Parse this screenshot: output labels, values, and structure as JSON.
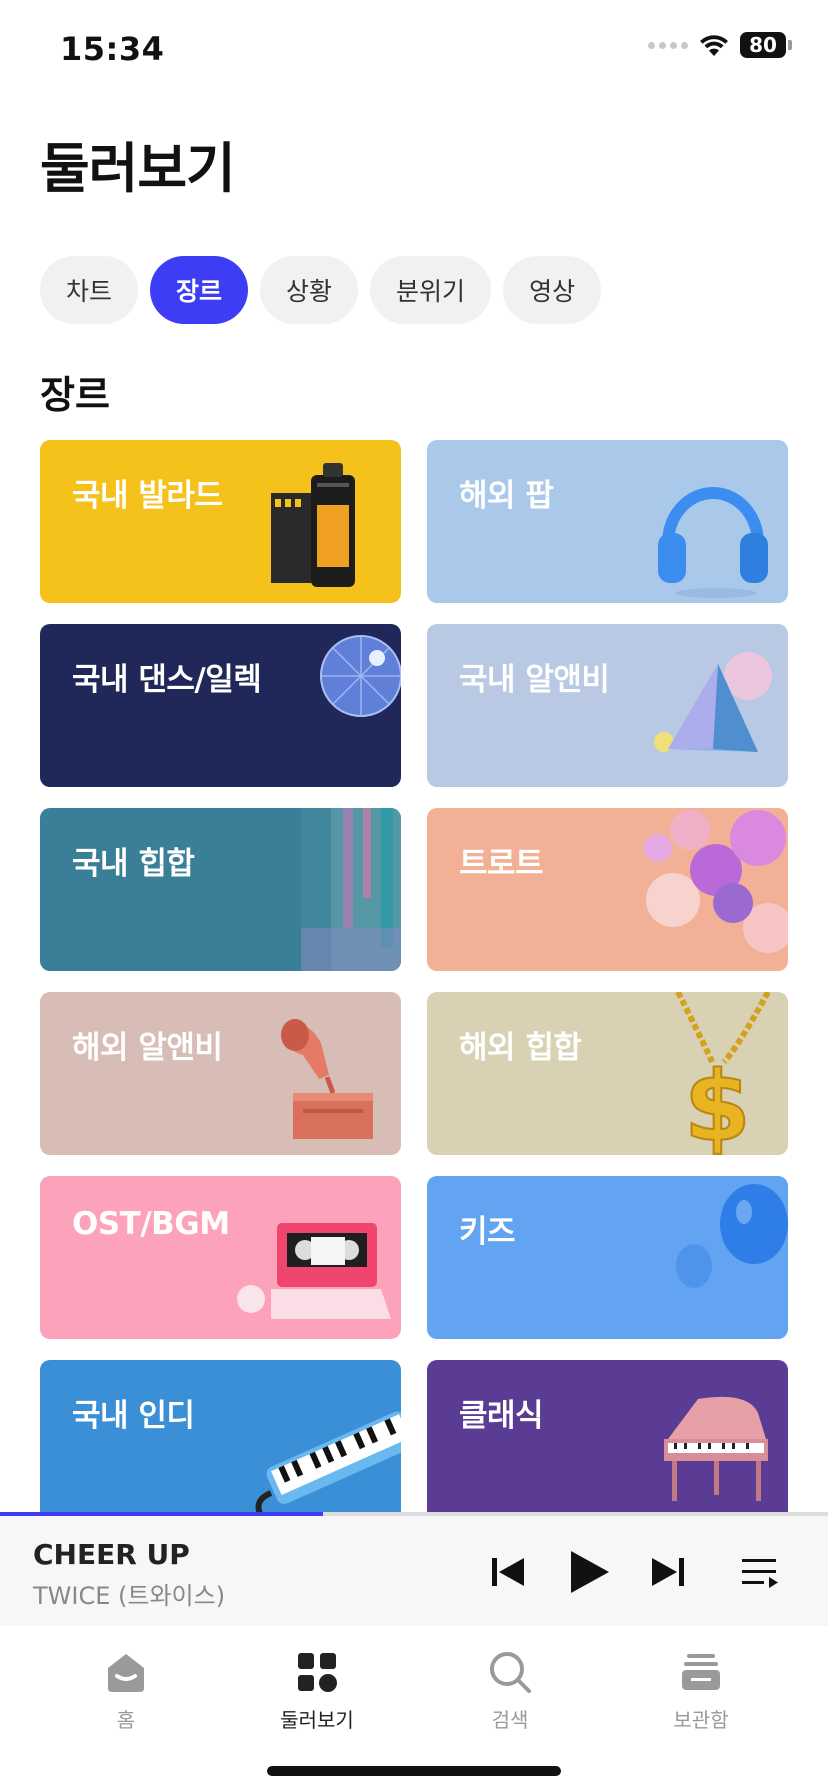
{
  "status_bar": {
    "time": "15:34",
    "battery": "80"
  },
  "page_title": "둘러보기",
  "chips": [
    {
      "label": "차트",
      "active": false
    },
    {
      "label": "장르",
      "active": true
    },
    {
      "label": "상황",
      "active": false
    },
    {
      "label": "분위기",
      "active": false
    },
    {
      "label": "영상",
      "active": false
    }
  ],
  "section_title": "장르",
  "genres": [
    {
      "label": "국내 발라드",
      "color": "#f5c21b",
      "icon": "film-canister-icon"
    },
    {
      "label": "해외 팝",
      "color": "#a9c8ea",
      "icon": "headphones-icon"
    },
    {
      "label": "국내 댄스/일렉",
      "color": "#1f2858",
      "icon": "disco-ball-icon"
    },
    {
      "label": "국내 알앤비",
      "color": "#b9c9e4",
      "icon": "prism-icon"
    },
    {
      "label": "국내 힙합",
      "color": "#3a7f98",
      "icon": "paint-drip-icon"
    },
    {
      "label": "트로트",
      "color": "#f2b196",
      "icon": "sequins-icon"
    },
    {
      "label": "해외 알앤비",
      "color": "#d8bdb6",
      "icon": "gramophone-icon"
    },
    {
      "label": "해외 힙합",
      "color": "#d8d1b3",
      "icon": "dollar-chain-icon"
    },
    {
      "label": "OST/BGM",
      "color": "#fca3bb",
      "icon": "vhs-tape-icon"
    },
    {
      "label": "키즈",
      "color": "#62a4f2",
      "icon": "balloon-icon"
    },
    {
      "label": "국내 인디",
      "color": "#3b8fd6",
      "icon": "melodica-icon"
    },
    {
      "label": "클래식",
      "color": "#5a3c94",
      "icon": "grand-piano-icon"
    }
  ],
  "player": {
    "title": "CHEER UP",
    "artist": "TWICE (트와이스)",
    "progress": 0.39
  },
  "tabs": [
    {
      "label": "홈",
      "icon": "home-icon",
      "active": false
    },
    {
      "label": "둘러보기",
      "icon": "browse-grid-icon",
      "active": true
    },
    {
      "label": "검색",
      "icon": "search-icon",
      "active": false
    },
    {
      "label": "보관함",
      "icon": "library-icon",
      "active": false
    }
  ],
  "accent_color": "#3d3df5"
}
